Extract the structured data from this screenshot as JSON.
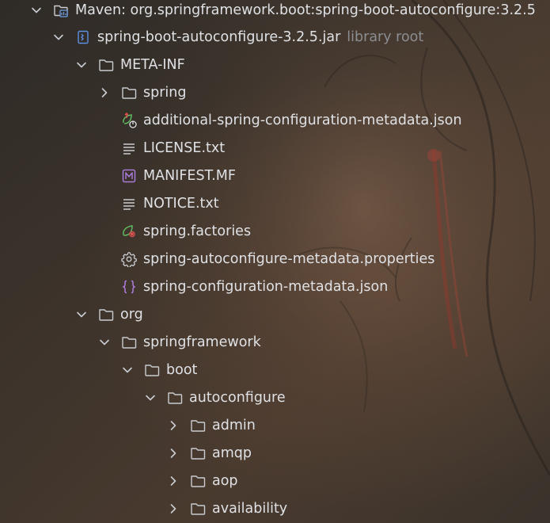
{
  "tree": {
    "rows": [
      {
        "label": "Maven: org.springframework.boot:spring-boot-autoconfigure:3.2.5",
        "suffix": "",
        "icon": "maven-library-icon",
        "expand": "open"
      },
      {
        "label": "spring-boot-autoconfigure-3.2.5.jar",
        "suffix": "library root",
        "icon": "jar-icon",
        "expand": "open"
      },
      {
        "label": "META-INF",
        "suffix": "",
        "icon": "folder-icon",
        "expand": "open"
      },
      {
        "label": "spring",
        "suffix": "",
        "icon": "folder-icon",
        "expand": "closed"
      },
      {
        "label": "additional-spring-configuration-metadata.json",
        "suffix": "",
        "icon": "spring-json-icon",
        "expand": "none"
      },
      {
        "label": "LICENSE.txt",
        "suffix": "",
        "icon": "text-file-icon",
        "expand": "none"
      },
      {
        "label": "MANIFEST.MF",
        "suffix": "",
        "icon": "manifest-icon",
        "expand": "none"
      },
      {
        "label": "NOTICE.txt",
        "suffix": "",
        "icon": "text-file-icon",
        "expand": "none"
      },
      {
        "label": "spring.factories",
        "suffix": "",
        "icon": "spring-factories-icon",
        "expand": "none"
      },
      {
        "label": "spring-autoconfigure-metadata.properties",
        "suffix": "",
        "icon": "gear-icon",
        "expand": "none"
      },
      {
        "label": "spring-configuration-metadata.json",
        "suffix": "",
        "icon": "json-braces-icon",
        "expand": "none"
      },
      {
        "label": "org",
        "suffix": "",
        "icon": "folder-icon",
        "expand": "open"
      },
      {
        "label": "springframework",
        "suffix": "",
        "icon": "folder-icon",
        "expand": "open"
      },
      {
        "label": "boot",
        "suffix": "",
        "icon": "folder-icon",
        "expand": "open"
      },
      {
        "label": "autoconfigure",
        "suffix": "",
        "icon": "folder-icon",
        "expand": "open"
      },
      {
        "label": "admin",
        "suffix": "",
        "icon": "folder-icon",
        "expand": "closed"
      },
      {
        "label": "amqp",
        "suffix": "",
        "icon": "folder-icon",
        "expand": "closed"
      },
      {
        "label": "aop",
        "suffix": "",
        "icon": "folder-icon",
        "expand": "closed"
      },
      {
        "label": "availability",
        "suffix": "",
        "icon": "folder-icon",
        "expand": "closed"
      }
    ]
  },
  "colors": {
    "text": "#dfe1e5",
    "muted": "#8b8d91",
    "jar_accent": "#3d7bd8",
    "spring_green": "#5fb85f",
    "manifest_purple": "#a77bd6",
    "json_purple": "#b07ee0",
    "spring_red": "#e05252"
  }
}
